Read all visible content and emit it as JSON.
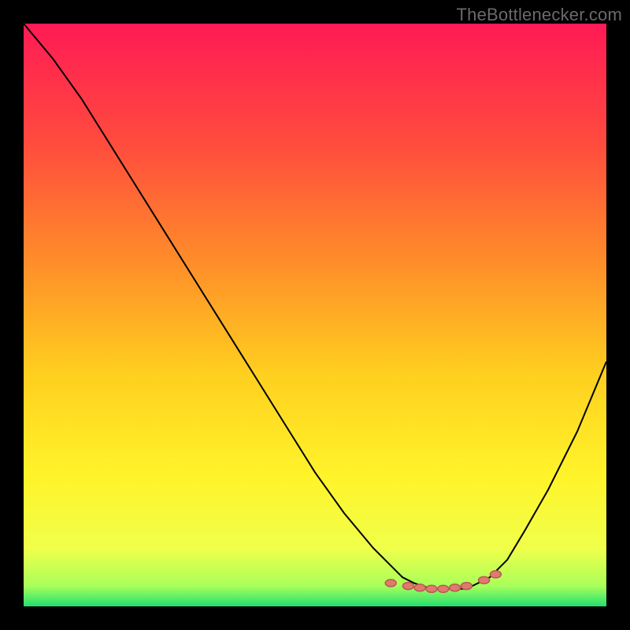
{
  "attribution": "TheBottlenecker.com",
  "chart_data": {
    "type": "line",
    "title": "",
    "xlabel": "",
    "ylabel": "",
    "xlim": [
      0,
      100
    ],
    "ylim": [
      0,
      100
    ],
    "x": [
      0,
      5,
      10,
      15,
      20,
      25,
      30,
      35,
      40,
      45,
      50,
      55,
      60,
      63,
      65,
      67,
      70,
      73,
      76,
      78,
      80,
      83,
      86,
      90,
      95,
      100
    ],
    "y": [
      100,
      94,
      87,
      79,
      71,
      63,
      55,
      47,
      39,
      31,
      23,
      16,
      10,
      7,
      5,
      4,
      3,
      3,
      3,
      4,
      5,
      8,
      13,
      20,
      30,
      42
    ],
    "markers": {
      "x": [
        63,
        66,
        68,
        70,
        72,
        74,
        76,
        79,
        81
      ],
      "y": [
        4,
        3.5,
        3.2,
        3,
        3,
        3.2,
        3.5,
        4.5,
        5.5
      ]
    },
    "gradient_stops": [
      {
        "offset": 0.0,
        "color": "#ff1a55"
      },
      {
        "offset": 0.2,
        "color": "#ff4a3e"
      },
      {
        "offset": 0.4,
        "color": "#ff8a2a"
      },
      {
        "offset": 0.6,
        "color": "#ffcf1f"
      },
      {
        "offset": 0.78,
        "color": "#fff42a"
      },
      {
        "offset": 0.9,
        "color": "#f0ff4a"
      },
      {
        "offset": 0.965,
        "color": "#a9ff5a"
      },
      {
        "offset": 1.0,
        "color": "#22e06f"
      }
    ]
  }
}
